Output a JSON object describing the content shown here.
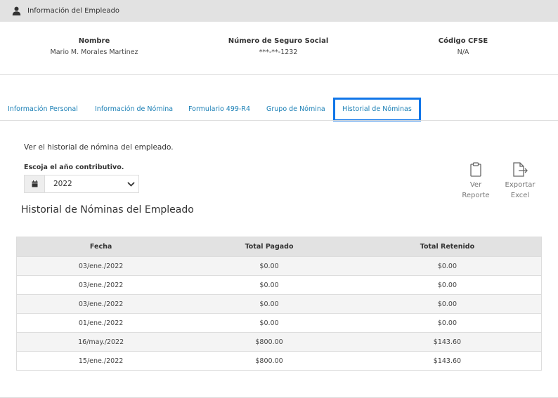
{
  "header": {
    "title": "Información del Empleado",
    "icon": "user-icon"
  },
  "employee": {
    "name_label": "Nombre",
    "name_value": "Mario M. Morales Martinez",
    "ssn_label": "Número de Seguro Social",
    "ssn_value": "***-**-1232",
    "cfse_label": "Código CFSE",
    "cfse_value": "N/A"
  },
  "tabs": [
    {
      "label": "Información Personal"
    },
    {
      "label": "Información de Nómina"
    },
    {
      "label": "Formulario 499-R4"
    },
    {
      "label": "Grupo de Nómina"
    },
    {
      "label": "Historial de Nóminas",
      "active": true
    }
  ],
  "intro": "Ver el historial de nómina del empleado.",
  "year_label": "Escoja el año contributivo.",
  "year_value": "2022",
  "actions": {
    "report_line1": "Ver",
    "report_line2": "Reporte",
    "excel_line1": "Exportar",
    "excel_line2": "Excel"
  },
  "section_title": "Historial de Nóminas del Empleado",
  "table": {
    "headers": [
      "Fecha",
      "Total Pagado",
      "Total Retenido"
    ],
    "rows": [
      [
        "03/ene./2022",
        "$0.00",
        "$0.00"
      ],
      [
        "03/ene./2022",
        "$0.00",
        "$0.00"
      ],
      [
        "03/ene./2022",
        "$0.00",
        "$0.00"
      ],
      [
        "01/ene./2022",
        "$0.00",
        "$0.00"
      ],
      [
        "16/may./2022",
        "$800.00",
        "$143.60"
      ],
      [
        "15/ene./2022",
        "$800.00",
        "$143.60"
      ]
    ]
  },
  "colors": {
    "accent": "#1176e8",
    "link": "#1a7fb5",
    "header_bg": "#e2e2e2"
  }
}
